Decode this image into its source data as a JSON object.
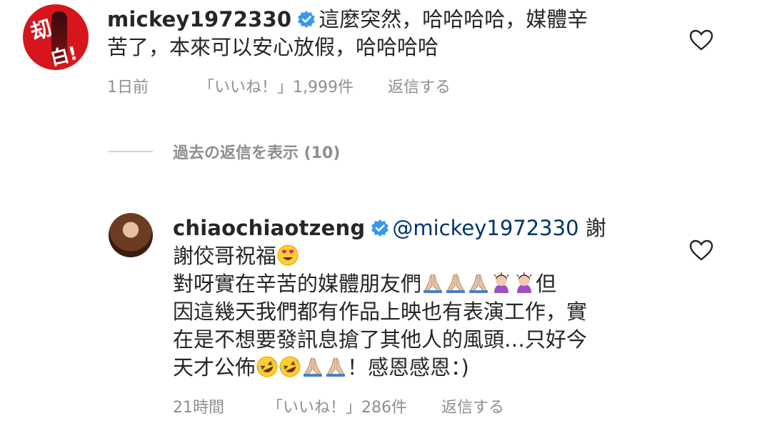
{
  "comment1": {
    "username": "mickey1972330",
    "text_line1": "這麼突然，哈哈哈哈，媒體辛",
    "text_line2": "苦了，本來可以安心放假，哈哈哈哈",
    "time": "1日前",
    "likes": "「いいね！」1,999件",
    "reply": "返信する"
  },
  "view_replies": "過去の返信を表示 (10)",
  "comment2": {
    "username": "chiaochiaotzeng",
    "mention": "@mickey1972330",
    "line1_tail": " 謝",
    "line2": "謝佼哥祝福",
    "line3_a": "對呀實在辛苦的媒體朋友們",
    "line3_b": "但",
    "line4": "因這幾天我們都有作品上映也有表演工作，實",
    "line5": "在是不想要發訊息搶了其他人的風頭…只好今",
    "line6_a": "天才公佈",
    "line6_b": "！感恩感恩：)",
    "time": "21時間",
    "likes": "「いいね！」286件",
    "reply": "返信する"
  },
  "colors": {
    "text": "#262626",
    "secondary": "#8e8e8e",
    "verified": "#3897f0",
    "mention": "#003569"
  },
  "icons": {
    "verified": "verified-badge-icon",
    "heart": "heart-outline-icon",
    "pray": "folded-hands-emoji",
    "heart_eyes": "heart-eyes-emoji",
    "rofl": "rofl-emoji",
    "woman_gesture": "woman-gesturing-emoji"
  }
}
